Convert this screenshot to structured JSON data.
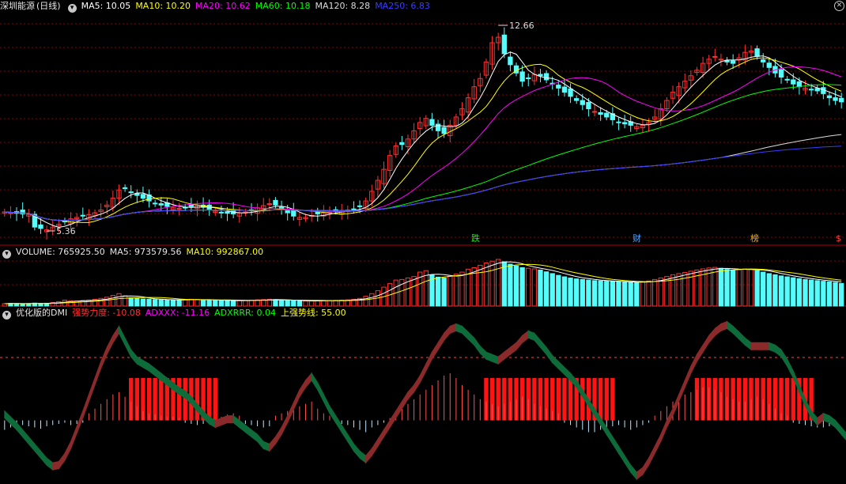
{
  "price_panel": {
    "stock_name": "深圳能源",
    "period": "(日线)",
    "indicators": [
      {
        "label": "MA5: 10.05",
        "color": "#ffffff"
      },
      {
        "label": "MA10: 10.20",
        "color": "#ffff00"
      },
      {
        "label": "MA20: 10.62",
        "color": "#ff00ff"
      },
      {
        "label": "MA60: 10.18",
        "color": "#00ff00"
      },
      {
        "label": "MA120: 8.28",
        "color": "#dcdcdc"
      },
      {
        "label": "MA250: 6.83",
        "color": "#3c3cff"
      }
    ],
    "high_label": "12.66",
    "low_label": "5.36",
    "event_tags": [
      {
        "text": "跌",
        "color": "#00ff00"
      },
      {
        "text": "财",
        "color": "#4aa8ff"
      },
      {
        "text": "榜",
        "color": "#ffb000"
      },
      {
        "text": "$",
        "color": "#ff4040"
      }
    ]
  },
  "volume_panel": {
    "title": "VOLUME: 765925.50",
    "ma5": "MA5: 973579.56",
    "ma10": "MA10: 992867.00"
  },
  "dmi_panel": {
    "title": "优化版的DMI",
    "strength": "强势力度: -10.08",
    "adxxx": "ADXXX: -11.16",
    "adxrrr": "ADXRRR: 0.04",
    "upper_line": "上强势线: 55.00"
  },
  "colors": {
    "up": "#ff3232",
    "down": "#54fcfc",
    "grid": "#8b0000",
    "dmi_up": "#8b2a2a",
    "dmi_down": "#0e6b3a"
  },
  "chart_data": [
    {
      "type": "candlestick",
      "title": "深圳能源 (日线)",
      "x_count": 140,
      "price_min": 5.36,
      "price_max": 12.66,
      "closes": [
        6.05,
        6.02,
        6.0,
        5.98,
        5.96,
        5.5,
        5.45,
        5.4,
        5.5,
        5.6,
        5.7,
        5.8,
        5.85,
        5.9,
        5.95,
        6.02,
        6.12,
        6.3,
        6.55,
        6.85,
        6.9,
        6.75,
        6.65,
        6.55,
        6.45,
        6.35,
        6.3,
        6.25,
        6.2,
        6.18,
        6.2,
        6.25,
        6.3,
        6.22,
        6.15,
        6.08,
        6.02,
        6.0,
        5.98,
        6.02,
        6.05,
        6.12,
        6.2,
        6.28,
        6.35,
        6.3,
        6.15,
        6.02,
        5.9,
        5.85,
        5.85,
        5.92,
        5.98,
        6.02,
        6.05,
        6.08,
        6.1,
        6.12,
        6.15,
        6.25,
        6.45,
        6.8,
        7.2,
        7.6,
        8.1,
        8.45,
        8.5,
        8.7,
        9.0,
        9.3,
        9.45,
        9.2,
        9.0,
        8.9,
        9.2,
        9.5,
        9.8,
        10.2,
        10.6,
        10.9,
        11.5,
        12.2,
        12.4,
        11.8,
        11.4,
        11.1,
        10.8,
        10.9,
        11.05,
        11.0,
        10.85,
        10.7,
        10.55,
        10.4,
        10.25,
        10.1,
        9.95,
        9.8,
        9.7,
        9.6,
        9.5,
        9.4,
        9.3,
        9.25,
        9.2,
        9.15,
        9.2,
        9.3,
        9.5,
        9.8,
        10.1,
        10.4,
        10.6,
        10.8,
        11.0,
        11.2,
        11.45,
        11.6,
        11.7,
        11.6,
        11.5,
        11.45,
        11.65,
        11.85,
        11.9,
        11.7,
        11.5,
        11.3,
        11.1,
        10.95,
        10.85,
        10.7,
        10.6,
        10.55,
        10.5,
        10.45,
        10.35,
        10.2,
        10.1,
        10.05
      ],
      "ma_series": [
        {
          "name": "MA5",
          "color": "#ffffff",
          "window": 5
        },
        {
          "name": "MA10",
          "color": "#ffff00",
          "window": 10
        },
        {
          "name": "MA20",
          "color": "#ff00ff",
          "window": 20
        },
        {
          "name": "MA60",
          "color": "#00ff00",
          "window": 60
        },
        {
          "name": "MA120",
          "color": "#dcdcdc",
          "window": 120
        },
        {
          "name": "MA250",
          "color": "#3c3cff",
          "window": 250
        }
      ]
    },
    {
      "type": "bar",
      "title": "VOLUME",
      "values": [
        80000,
        90000,
        85000,
        80000,
        85000,
        100000,
        90000,
        95000,
        120000,
        150000,
        200000,
        180000,
        170000,
        190000,
        200000,
        230000,
        260000,
        300000,
        360000,
        420000,
        350000,
        280000,
        260000,
        240000,
        230000,
        220000,
        210000,
        200000,
        205000,
        210000,
        220000,
        230000,
        220000,
        210000,
        200000,
        190000,
        185000,
        180000,
        182000,
        185000,
        190000,
        200000,
        210000,
        220000,
        230000,
        220000,
        200000,
        185000,
        175000,
        170000,
        170000,
        175000,
        180000,
        185000,
        190000,
        195000,
        200000,
        210000,
        230000,
        260000,
        330000,
        420000,
        520000,
        640000,
        760000,
        880000,
        900000,
        950000,
        1000000,
        1150000,
        1200000,
        1050000,
        980000,
        950000,
        1010000,
        1080000,
        1150000,
        1250000,
        1300000,
        1380000,
        1460000,
        1520000,
        1580000,
        1500000,
        1420000,
        1360000,
        1300000,
        1280000,
        1260000,
        1220000,
        1160000,
        1100000,
        1040000,
        990000,
        950000,
        920000,
        900000,
        880000,
        860000,
        850000,
        840000,
        830000,
        820000,
        810000,
        800000,
        800000,
        820000,
        850000,
        900000,
        950000,
        1000000,
        1060000,
        1100000,
        1140000,
        1180000,
        1220000,
        1260000,
        1290000,
        1310000,
        1280000,
        1240000,
        1210000,
        1230000,
        1260000,
        1250000,
        1200000,
        1150000,
        1100000,
        1060000,
        1020000,
        990000,
        960000,
        930000,
        900000,
        880000,
        860000,
        840000,
        820000,
        800000,
        765925.5
      ],
      "ma_series": [
        {
          "name": "MA5",
          "color": "#ffffff",
          "window": 5
        },
        {
          "name": "MA10",
          "color": "#ffff00",
          "window": 10
        }
      ]
    },
    {
      "type": "area",
      "title": "优化版的DMI",
      "upper_line": 55.0,
      "ylim": [
        -50,
        85
      ],
      "strength": [
        8,
        3,
        -2,
        -8,
        -14,
        -20,
        -26,
        -32,
        -36,
        -35,
        -28,
        -18,
        -5,
        8,
        22,
        36,
        50,
        62,
        72,
        80,
        70,
        60,
        54,
        51,
        48,
        44,
        40,
        36,
        32,
        28,
        25,
        20,
        14,
        8,
        3,
        0,
        2,
        4,
        4,
        0,
        -4,
        -8,
        -12,
        -18,
        -20,
        -14,
        -6,
        4,
        15,
        26,
        34,
        40,
        32,
        22,
        12,
        4,
        -4,
        -12,
        -20,
        -26,
        -30,
        -24,
        -16,
        -8,
        0,
        8,
        16,
        24,
        30,
        38,
        48,
        58,
        66,
        74,
        80,
        82,
        80,
        75,
        70,
        63,
        58,
        56,
        54,
        58,
        62,
        66,
        72,
        76,
        74,
        68,
        62,
        55,
        50,
        45,
        40,
        34,
        26,
        18,
        10,
        2,
        -6,
        -14,
        -22,
        -30,
        -38,
        -44,
        -40,
        -32,
        -22,
        -12,
        0,
        10,
        22,
        34,
        46,
        56,
        64,
        72,
        78,
        82,
        84,
        80,
        75,
        70,
        66,
        66,
        66,
        66,
        64,
        60,
        52,
        42,
        30,
        18,
        8,
        2,
        6,
        4,
        0,
        -6,
        -12,
        -15
      ],
      "volatility": [
        -8,
        -6,
        -5,
        -4,
        -5,
        -6,
        -7,
        -5,
        -4,
        -3,
        -2,
        -4,
        -3,
        -2,
        6,
        10,
        14,
        18,
        22,
        24,
        20,
        16,
        12,
        8,
        6,
        5,
        4,
        3,
        3,
        2,
        -2,
        -3,
        -4,
        -3,
        -2,
        -2,
        3,
        5,
        6,
        4,
        -3,
        -4,
        -5,
        -6,
        -5,
        4,
        6,
        8,
        10,
        12,
        14,
        16,
        10,
        6,
        4,
        -2,
        -3,
        -4,
        -6,
        -8,
        -10,
        -6,
        -4,
        -2,
        2,
        6,
        10,
        14,
        18,
        22,
        26,
        30,
        34,
        38,
        40,
        36,
        30,
        26,
        22,
        18,
        16,
        14,
        12,
        14,
        16,
        18,
        20,
        18,
        14,
        12,
        10,
        8,
        6,
        -2,
        -4,
        -6,
        -8,
        -10,
        -10,
        -8,
        -6,
        -5,
        -4,
        -6,
        -8,
        -6,
        -4,
        -2,
        4,
        8,
        12,
        16,
        20,
        22,
        24,
        26,
        28,
        28,
        26,
        24,
        20,
        18,
        16,
        16,
        18,
        20,
        18,
        14,
        10,
        6,
        4,
        -2,
        -3,
        -4,
        -5,
        -6,
        -6,
        -5,
        -4
      ],
      "pulses_up": [
        [
          21,
          35
        ],
        [
          80,
          101
        ],
        [
          115,
          134
        ]
      ],
      "pulse_thin": [
        [
          36,
          46
        ],
        [
          102,
          110
        ],
        [
          135,
          139
        ]
      ]
    }
  ]
}
